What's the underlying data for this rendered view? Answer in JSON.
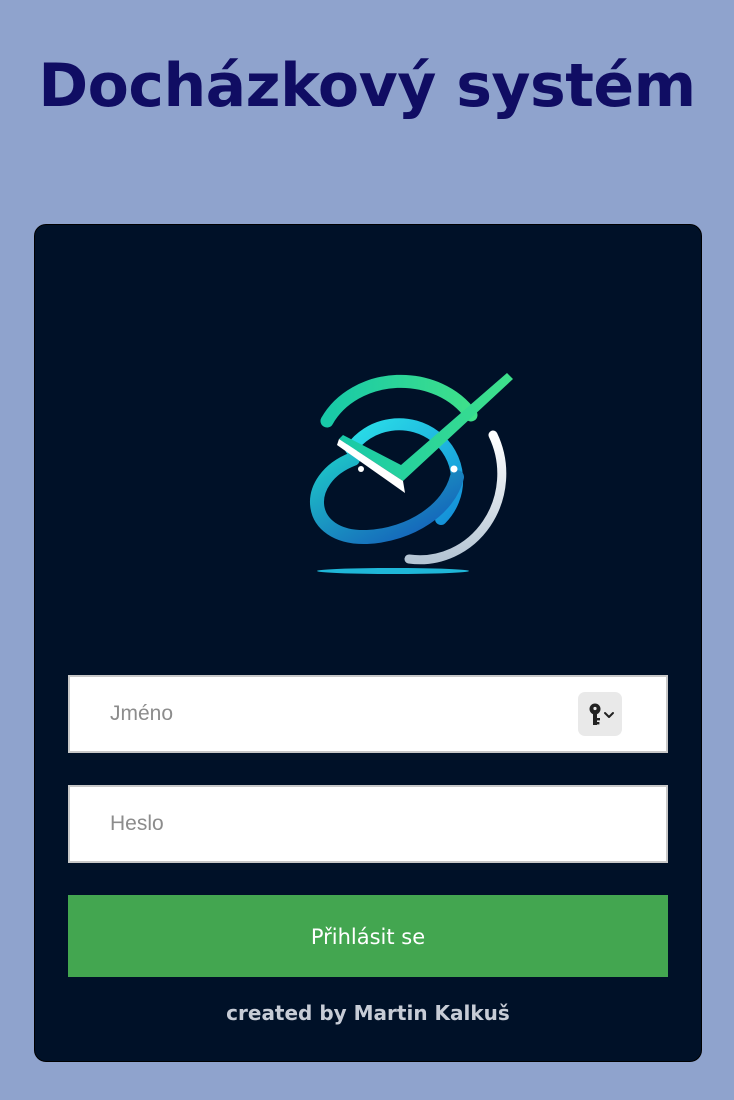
{
  "header": {
    "title": "Docházkový systém"
  },
  "logo": {
    "icon": "checkmark-circle-logo-icon"
  },
  "form": {
    "username_placeholder": "Jméno",
    "password_placeholder": "Heslo",
    "key_icon": "key-icon",
    "submit_label": "Přihlásit se"
  },
  "footer": {
    "credit": "created by Martin Kalkuš"
  },
  "colors": {
    "background": "#8fa3cd",
    "title": "#100d63",
    "card": "#001128",
    "button": "#43a650",
    "logo_green": "#1fd391",
    "logo_cyan": "#20c4e6",
    "logo_blue": "#1a6fc4"
  }
}
